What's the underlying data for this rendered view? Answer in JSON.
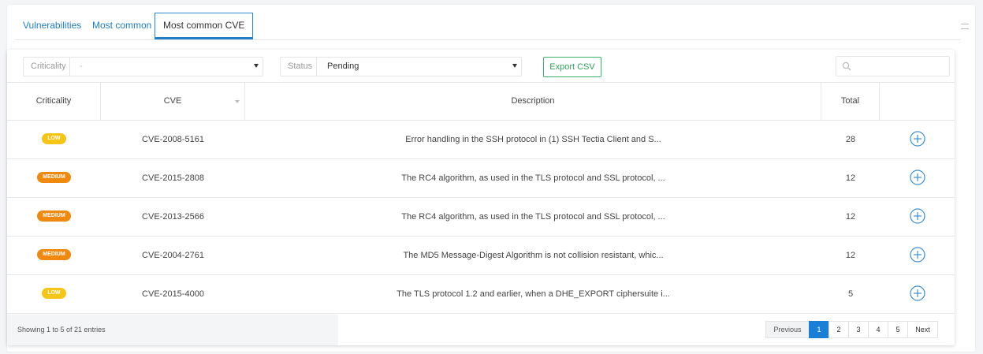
{
  "tabs": [
    {
      "label": "Vulnerabilities",
      "active": false
    },
    {
      "label": "Most common",
      "active": false
    },
    {
      "label": "Most common CVE",
      "active": true
    }
  ],
  "filters": {
    "criticality": {
      "label": "Criticality",
      "value": "-"
    },
    "status": {
      "label": "Status",
      "value": "Pending"
    },
    "export_label": "Export CSV",
    "search_placeholder": ""
  },
  "table": {
    "columns": [
      "Criticality",
      "CVE",
      "Description",
      "Total",
      ""
    ],
    "rows": [
      {
        "criticality": "LOW",
        "level": "low",
        "cve": "CVE-2008-5161",
        "description": "Error handling in the SSH protocol in (1) SSH Tectia Client and S...",
        "total": "28"
      },
      {
        "criticality": "MEDIUM",
        "level": "medium",
        "cve": "CVE-2015-2808",
        "description": "The RC4 algorithm, as used in the TLS protocol and SSL protocol, ...",
        "total": "12"
      },
      {
        "criticality": "MEDIUM",
        "level": "medium",
        "cve": "CVE-2013-2566",
        "description": "The RC4 algorithm, as used in the TLS protocol and SSL protocol, ...",
        "total": "12"
      },
      {
        "criticality": "MEDIUM",
        "level": "medium",
        "cve": "CVE-2004-2761",
        "description": "The MD5 Message-Digest Algorithm is not collision resistant, whic...",
        "total": "12"
      },
      {
        "criticality": "LOW",
        "level": "low",
        "cve": "CVE-2015-4000",
        "description": "The TLS protocol 1.2 and earlier, when a DHE_EXPORT ciphersuite i...",
        "total": "5"
      }
    ]
  },
  "footer": {
    "showing": "Showing 1 to 5 of 21 entries",
    "pagination": {
      "previous": "Previous",
      "pages": [
        "1",
        "2",
        "3",
        "4",
        "5"
      ],
      "current": "1",
      "next": "Next"
    }
  },
  "colors": {
    "accent": "#1e7fc6",
    "low": "#f5c518",
    "medium": "#f0890f",
    "export": "#39b36a",
    "page_active": "#1a7fd6"
  },
  "icons": {
    "add": "plus-circle-icon",
    "search": "search-icon",
    "menu": "menu-icon"
  }
}
